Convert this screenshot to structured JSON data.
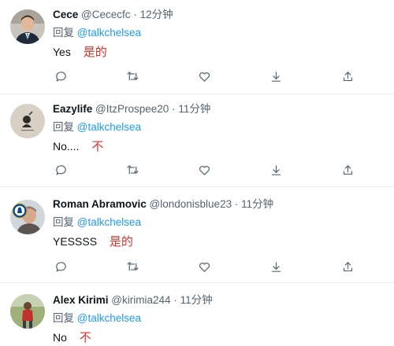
{
  "tweets": [
    {
      "name": "Cece",
      "handle": "@Cececfc",
      "time": "12分钟",
      "reply_prefix": "回复",
      "reply_to": "@talkchelsea",
      "text": "Yes",
      "annotation": "是的"
    },
    {
      "name": "Eazylife",
      "handle": "@ItzProspee20",
      "time": "11分钟",
      "reply_prefix": "回复",
      "reply_to": "@talkchelsea",
      "text": "No....",
      "annotation": "不"
    },
    {
      "name": "Roman Abramovic",
      "handle": "@londonisblue23",
      "time": "11分钟",
      "reply_prefix": "回复",
      "reply_to": "@talkchelsea",
      "text": "YESSSS",
      "annotation": "是的"
    },
    {
      "name": "Alex Kirimi",
      "handle": "@kirimia244",
      "time": "11分钟",
      "reply_prefix": "回复",
      "reply_to": "@talkchelsea",
      "text": "No",
      "annotation": "不"
    }
  ],
  "separator": "·",
  "action_icons": [
    "reply-icon",
    "retweet-icon",
    "like-icon",
    "download-icon",
    "share-icon"
  ],
  "colors": {
    "name": "#0f1419",
    "secondary": "#536471",
    "mention": "#1d9bf0",
    "annotation": "#e0302a",
    "divider": "#e6ecf0"
  }
}
